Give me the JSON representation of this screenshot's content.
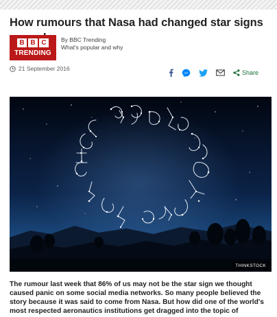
{
  "article": {
    "headline": "How rumours that Nasa had changed star signs spread",
    "byline": {
      "logo_letters": [
        "B",
        "B",
        "C"
      ],
      "logo_word": "TRENDING",
      "author": "By BBC Trending",
      "tagline": "What's popular and why"
    },
    "date": "21 September 2016",
    "share": {
      "icons": [
        "facebook-icon",
        "messenger-icon",
        "twitter-icon",
        "email-icon"
      ],
      "label": "Share"
    },
    "image": {
      "subject": "zodiac constellations circle in night sky",
      "credit": "THINKSTOCK"
    },
    "intro_lines": [
      "The rumour last week that 86% of us may not be the star sign we thought",
      "caused panic on some social media networks. So many people believed the",
      "story because it was said to come from Nasa. But how did one of the world's",
      "most respected aeronautics institutions get dragged into the topic of"
    ]
  },
  "colors": {
    "brand_red": "#bb1919",
    "facebook": "#3b5998",
    "messenger": "#0084ff",
    "twitter": "#1da1f2",
    "share_green": "#1a6e3a"
  }
}
